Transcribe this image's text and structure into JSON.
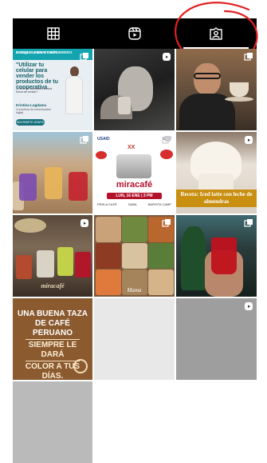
{
  "tabs": [
    {
      "icon": "grid-icon",
      "label": "Posts",
      "active": false
    },
    {
      "icon": "reels-icon",
      "label": "Reels",
      "active": false
    },
    {
      "icon": "tagged-icon",
      "label": "Tagged",
      "active": true
    }
  ],
  "annotation_color": "#e02020",
  "posts": [
    {
      "type": "carousel",
      "header": "BLOQUE 1 ANATOMÍA",
      "subheader": "BINGO LUNES 8 DE FEBRERO",
      "headline": "\"Utilizar tu celular para vender los productos de tu cooperativa",
      "desc": "¿Cómo ha cambiado nuestra forma de vender?",
      "name": "Kristina Lugdama",
      "role": "Consultora de comunicación digital",
      "button": "INSCRIBETE GRATIS"
    },
    {
      "type": "reel"
    },
    {
      "type": "carousel"
    },
    {
      "type": "carousel"
    },
    {
      "type": "carousel",
      "logos": [
        "USAID",
        "CBF"
      ],
      "mark": "XX",
      "brand": "miracafé",
      "date": "LUN, 16 ENE | 3 PM",
      "footer": [
        "PERLA CAFÉ",
        "SABA",
        "BARISTA CAMP"
      ]
    },
    {
      "type": "reel",
      "caption": "Receta: Iced latte con leche de almendras"
    },
    {
      "type": "reel",
      "sign": "miracafé"
    },
    {
      "type": "carousel",
      "caption": "Mama"
    },
    {
      "type": "carousel"
    },
    {
      "type": "post",
      "lines": [
        "UNA BUENA TAZA",
        "DE CAFÉ PERUANO",
        "SIEMPRE LE DARÁ",
        "COLOR A TUS DÍAS."
      ]
    },
    {
      "type": "carousel"
    },
    {
      "type": "reel"
    },
    {
      "type": "post"
    }
  ],
  "colors": {
    "tab_bg": "#000000",
    "icon": "#ffffff",
    "recipe_banner": "#c98f10",
    "quote_bg": "#8b5a2f"
  }
}
